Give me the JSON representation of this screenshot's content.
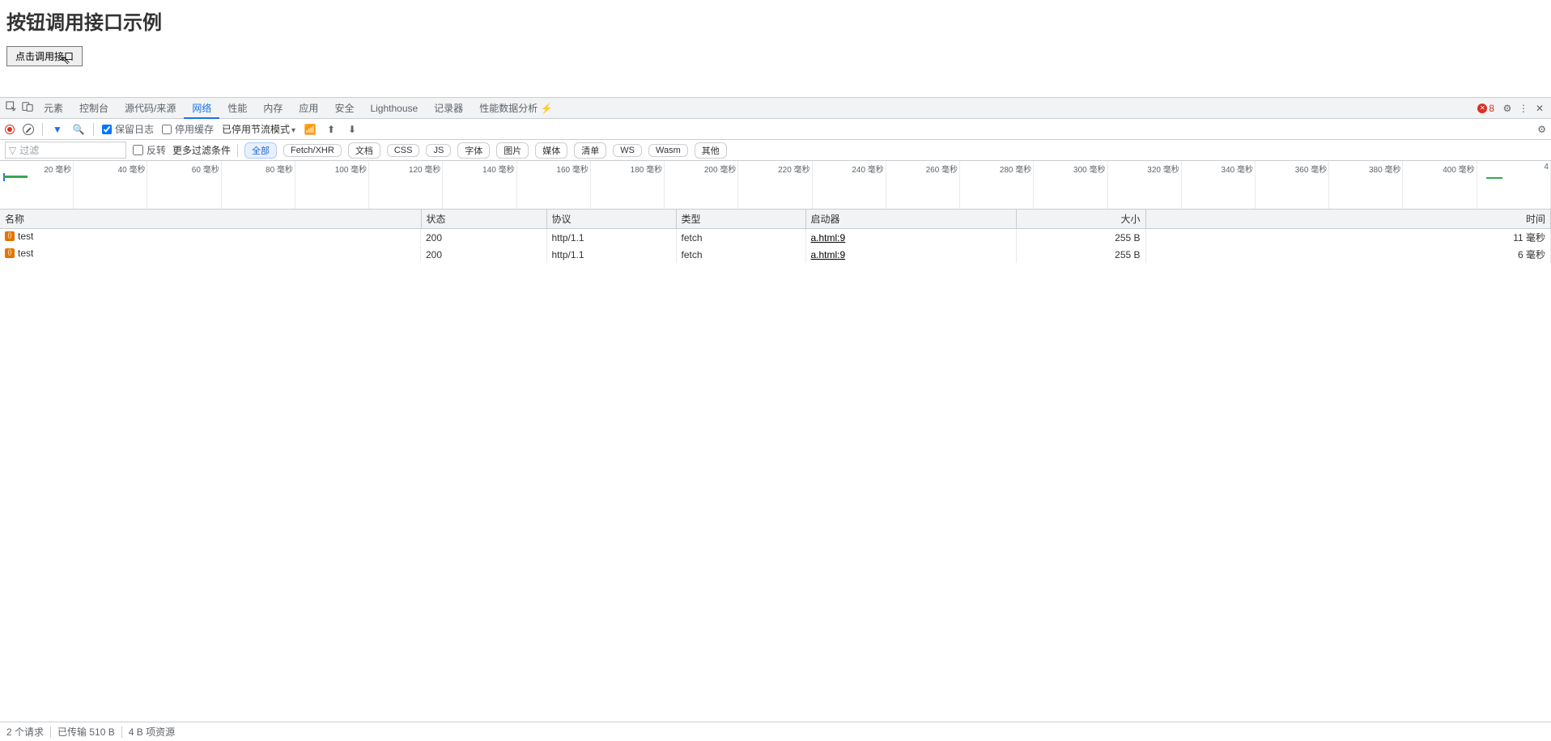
{
  "page": {
    "heading": "按钮调用接口示例",
    "button_label": "点击调用接口"
  },
  "devtools": {
    "tabs": [
      "元素",
      "控制台",
      "源代码/来源",
      "网络",
      "性能",
      "内存",
      "应用",
      "安全",
      "Lighthouse",
      "记录器",
      "性能数据分析 ⚡"
    ],
    "active_tab_index": 3,
    "error_count": "8",
    "toolbar": {
      "preserve_log_label": "保留日志",
      "preserve_log_checked": true,
      "disable_cache_label": "停用缓存",
      "disable_cache_checked": false,
      "throttling_label": "已停用节流模式"
    },
    "filterbar": {
      "filter_placeholder": "过滤",
      "invert_label": "反转",
      "more_filters_label": "更多过滤条件",
      "chips": [
        "全部",
        "Fetch/XHR",
        "文档",
        "CSS",
        "JS",
        "字体",
        "图片",
        "媒体",
        "清单",
        "WS",
        "Wasm",
        "其他"
      ],
      "active_chip_index": 0
    },
    "timeline_ticks": [
      "20 毫秒",
      "40 毫秒",
      "60 毫秒",
      "80 毫秒",
      "100 毫秒",
      "120 毫秒",
      "140 毫秒",
      "160 毫秒",
      "180 毫秒",
      "200 毫秒",
      "220 毫秒",
      "240 毫秒",
      "260 毫秒",
      "280 毫秒",
      "300 毫秒",
      "320 毫秒",
      "340 毫秒",
      "360 毫秒",
      "380 毫秒",
      "400 毫秒",
      "4"
    ],
    "columns": [
      "名称",
      "状态",
      "协议",
      "类型",
      "启动器",
      "大小",
      "时间"
    ],
    "rows": [
      {
        "name": "test",
        "status": "200",
        "protocol": "http/1.1",
        "type": "fetch",
        "initiator": "a.html:9",
        "size": "255 B",
        "time": "11 毫秒"
      },
      {
        "name": "test",
        "status": "200",
        "protocol": "http/1.1",
        "type": "fetch",
        "initiator": "a.html:9",
        "size": "255 B",
        "time": "6 毫秒"
      }
    ],
    "status": {
      "requests": "2 个请求",
      "transferred": "已传输 510 B",
      "resources": "4 B 项资源"
    }
  }
}
